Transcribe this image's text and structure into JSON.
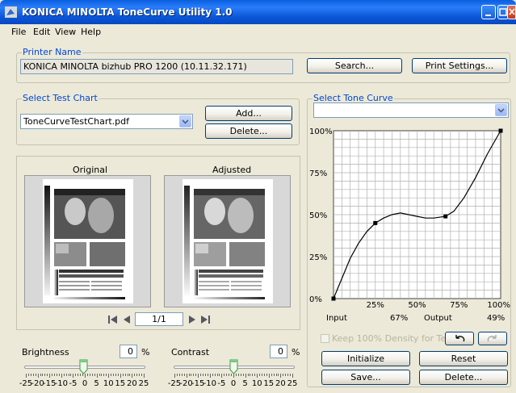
{
  "window": {
    "title": "KONICA MINOLTA ToneCurve Utility 1.0"
  },
  "menu": [
    "File",
    "Edit",
    "View",
    "Help"
  ],
  "printer": {
    "group_label": "Printer Name",
    "value": "KONICA MINOLTA bizhub PRO 1200 (10.11.32.171)",
    "search_label": "Search...",
    "print_settings_label": "Print Settings..."
  },
  "test_chart": {
    "group_label": "Select Test Chart",
    "selected": "ToneCurveTestChart.pdf",
    "add_label": "Add...",
    "delete_label": "Delete..."
  },
  "preview": {
    "original_label": "Original",
    "adjusted_label": "Adjusted",
    "page_indicator": "1/1"
  },
  "brightness": {
    "label": "Brightness",
    "value": "0",
    "unit": "%"
  },
  "contrast": {
    "label": "Contrast",
    "value": "0",
    "unit": "%"
  },
  "slider_scale": [
    "-25",
    "-20",
    "-15",
    "-10",
    "-5",
    "0",
    "5",
    "10",
    "15",
    "20",
    "25"
  ],
  "tone_curve": {
    "group_label": "Select Tone Curve",
    "selected": "",
    "keep_density_label": "Keep 100% Density for Text",
    "input_label": "Input",
    "input_value": "67%",
    "output_label": "Output",
    "output_value": "49%",
    "initialize_label": "Initialize",
    "reset_label": "Reset",
    "save_label": "Save...",
    "delete_label": "Delete...",
    "undo_icon": "undo-arrow-icon",
    "redo_icon": "redo-arrow-icon"
  },
  "chart_data": {
    "type": "line",
    "x_tick_labels": [
      "0%",
      "25%",
      "50%",
      "75%",
      "100%"
    ],
    "y_tick_labels": [
      "0%",
      "25%",
      "50%",
      "75%",
      "100%"
    ],
    "xlim": [
      0,
      100
    ],
    "ylim": [
      0,
      100
    ],
    "grid": true,
    "control_points": [
      {
        "x": 0,
        "y": 0
      },
      {
        "x": 25,
        "y": 45
      },
      {
        "x": 67,
        "y": 49
      },
      {
        "x": 100,
        "y": 100
      }
    ],
    "curve": [
      {
        "x": 0,
        "y": 0
      },
      {
        "x": 5,
        "y": 12
      },
      {
        "x": 10,
        "y": 24
      },
      {
        "x": 15,
        "y": 33
      },
      {
        "x": 20,
        "y": 40
      },
      {
        "x": 25,
        "y": 45
      },
      {
        "x": 30,
        "y": 48
      },
      {
        "x": 35,
        "y": 50
      },
      {
        "x": 40,
        "y": 51
      },
      {
        "x": 45,
        "y": 50
      },
      {
        "x": 50,
        "y": 49
      },
      {
        "x": 55,
        "y": 48
      },
      {
        "x": 60,
        "y": 48
      },
      {
        "x": 67,
        "y": 49
      },
      {
        "x": 72,
        "y": 52
      },
      {
        "x": 78,
        "y": 60
      },
      {
        "x": 85,
        "y": 72
      },
      {
        "x": 92,
        "y": 86
      },
      {
        "x": 100,
        "y": 100
      }
    ]
  }
}
